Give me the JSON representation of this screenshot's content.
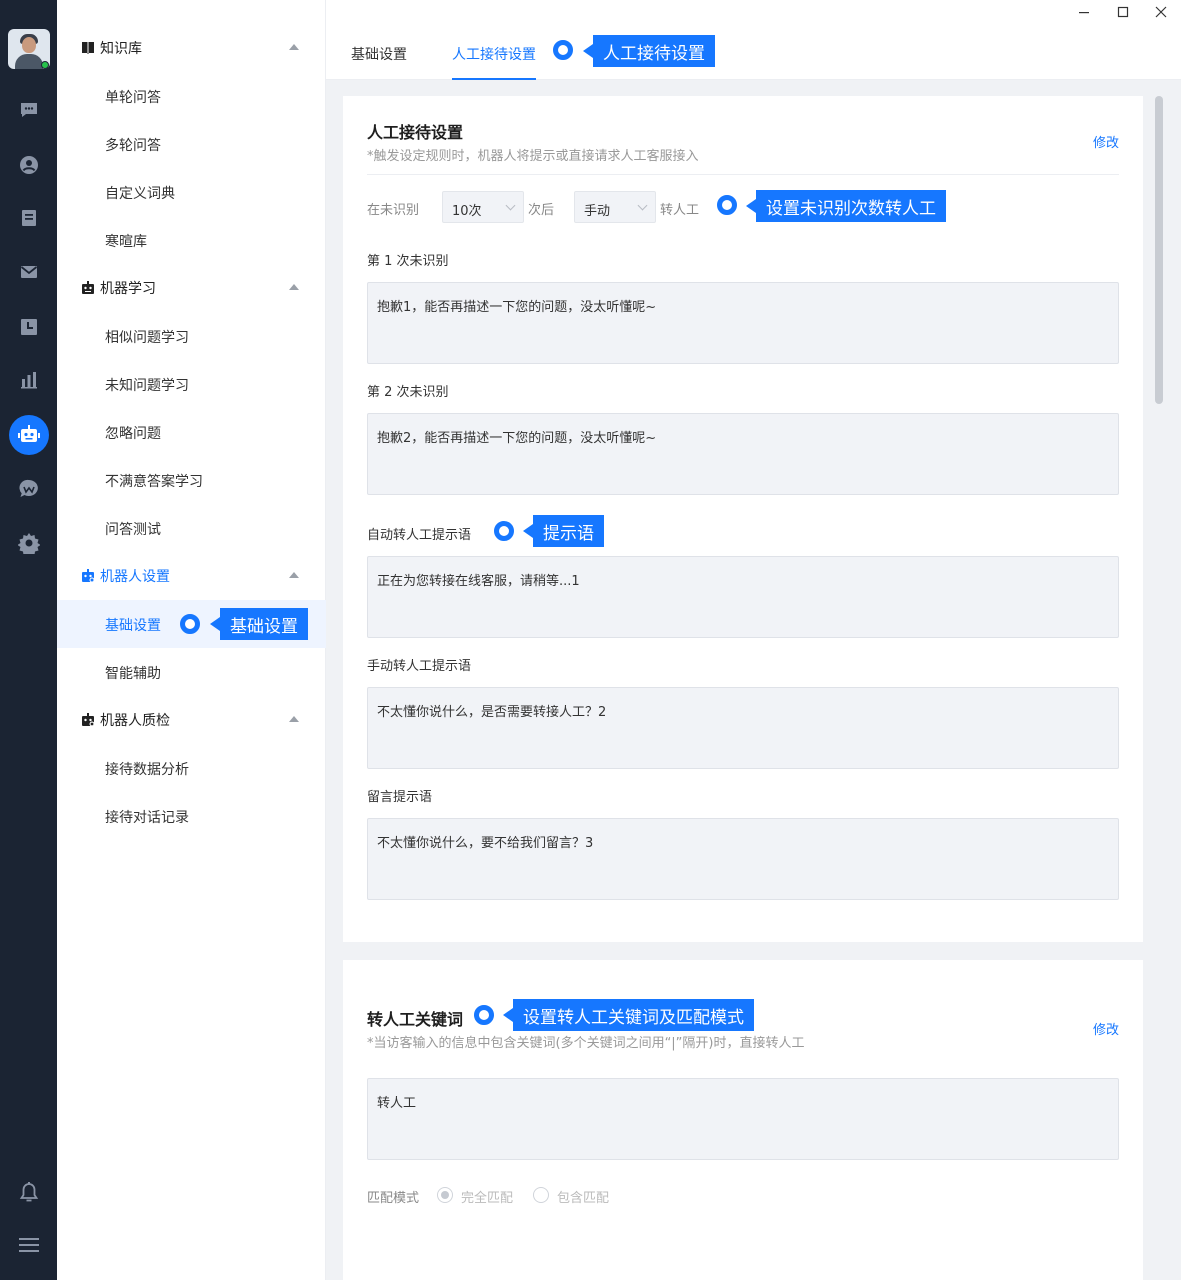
{
  "window": {
    "controls": [
      "minimize-icon",
      "maximize-icon",
      "close-icon"
    ]
  },
  "rail": {
    "items": [
      "chat-icon",
      "contact-icon",
      "order-icon",
      "mail-icon",
      "history-icon",
      "stats-icon",
      "robot-icon",
      "wechat-icon",
      "settings-icon"
    ],
    "bottom": [
      "bell-icon",
      "menu-icon"
    ],
    "active": "robot-icon",
    "accent": "#1677ff",
    "status_color": "#27c24c"
  },
  "sidebar": {
    "groups": [
      {
        "label": "知识库",
        "icon": "book-icon",
        "items": [
          "单轮问答",
          "多轮问答",
          "自定义词典",
          "寒暄库"
        ]
      },
      {
        "label": "机器学习",
        "icon": "robot-learn-icon",
        "items": [
          "相似问题学习",
          "未知问题学习",
          "忽略问题",
          "不满意答案学习",
          "问答测试"
        ]
      },
      {
        "label": "机器人设置",
        "icon": "robot-settings-icon",
        "items": [
          "基础设置",
          "智能辅助"
        ]
      },
      {
        "label": "机器人质检",
        "icon": "robot-qc-icon",
        "items": [
          "接待数据分析",
          "接待对话记录"
        ]
      }
    ],
    "active_item": "基础设置"
  },
  "tabs": {
    "items": [
      "基础设置",
      "人工接待设置"
    ],
    "active": "人工接待设置"
  },
  "card1": {
    "title": "人工接待设置",
    "hint": "*触发设定规则时，机器人将提示或直接请求人工客服接入",
    "edit": "修改",
    "rule": {
      "prefix": "在未识别",
      "count": "10次",
      "middle": "次后",
      "mode": "手动",
      "suffix": "转人工"
    },
    "fields": [
      {
        "label": "第 1 次未识别",
        "value": "抱歉1，能否再描述一下您的问题，没太听懂呢~"
      },
      {
        "label": "第 2 次未识别",
        "value": "抱歉2，能否再描述一下您的问题，没太听懂呢~"
      },
      {
        "label": "自动转人工提示语",
        "value": "正在为您转接在线客服，请稍等...1"
      },
      {
        "label": "手动转人工提示语",
        "value": "不太懂你说什么，是否需要转接人工？2"
      },
      {
        "label": "留言提示语",
        "value": "不太懂你说什么，要不给我们留言？3"
      }
    ]
  },
  "card2": {
    "title": "转人工关键词",
    "hint": "*当访客输入的信息中包含关键词(多个关键词之间用“|”隔开)时，直接转人工",
    "edit": "修改",
    "keyword_value": "转人工",
    "match_label": "匹配模式",
    "options": [
      "完全匹配",
      "包含匹配"
    ],
    "selected": "完全匹配"
  },
  "annotations": {
    "tab": "人工接待设置",
    "unrecognized": "设置未识别次数转人工",
    "prompt": "提示语",
    "basic": "基础设置",
    "keywords": "设置转人工关键词及匹配模式"
  }
}
